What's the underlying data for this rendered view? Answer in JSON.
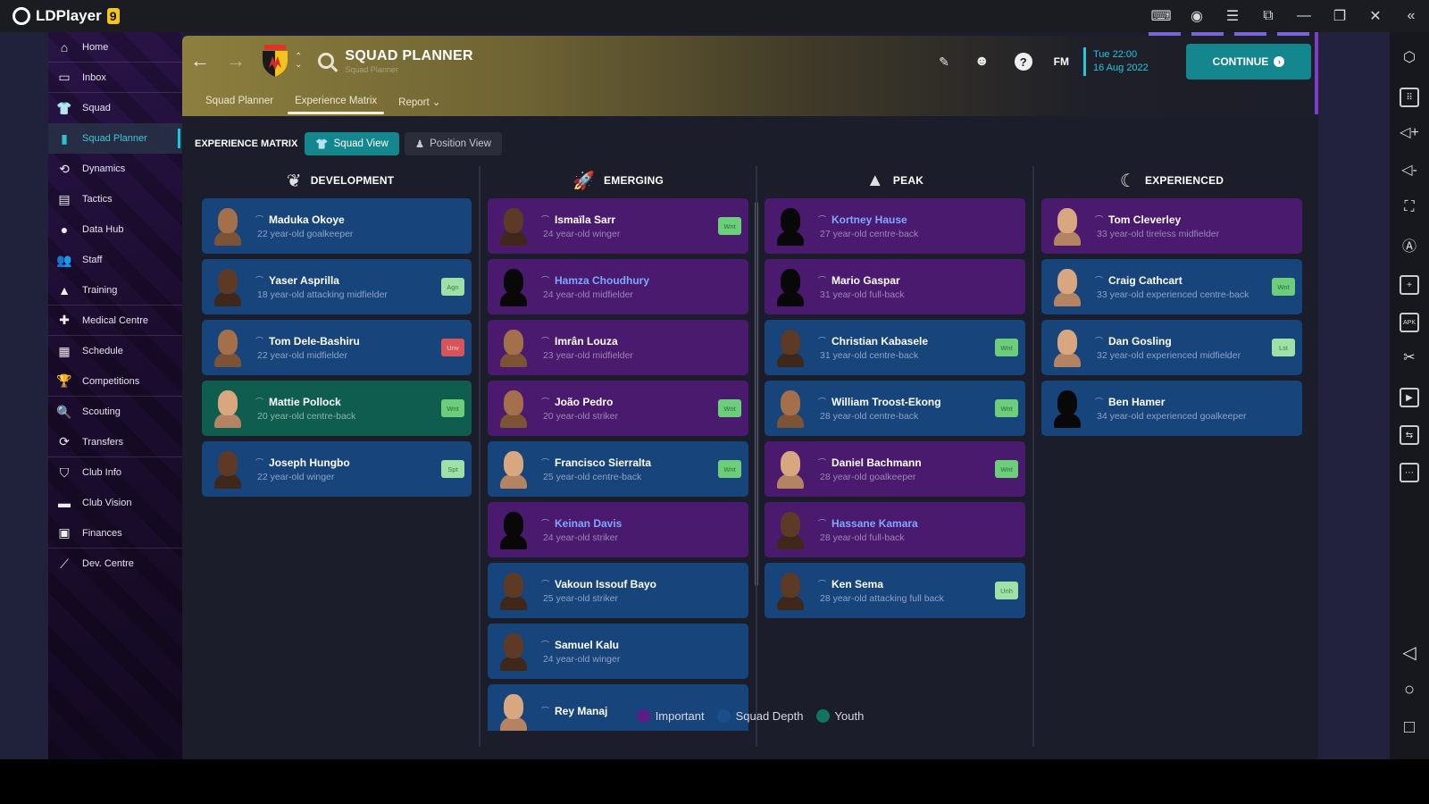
{
  "emulator": {
    "app_name": "LDPlayer",
    "version_badge": "9",
    "titlebar_icons": [
      "gamepad-icon",
      "account-icon",
      "menu-icon",
      "sync-icon",
      "minimize-icon",
      "restore-icon",
      "close-icon",
      "collapse-icon"
    ],
    "right_toolbar": [
      "settings-icon",
      "keyboard-icon",
      "volume-up-icon",
      "volume-down-icon",
      "fullscreen-icon",
      "rotate-icon",
      "multi-instance-icon",
      "apk-install-icon",
      "screenshot-icon",
      "record-icon",
      "sync-icon",
      "more-icon"
    ],
    "android_nav": [
      "back-icon",
      "home-icon",
      "recents-icon"
    ]
  },
  "sidebar": {
    "items": [
      {
        "label": "Home",
        "icon": "home-icon"
      },
      {
        "label": "Inbox",
        "icon": "inbox-icon"
      },
      {
        "label": "Squad",
        "icon": "shirt-icon"
      },
      {
        "label": "Squad Planner",
        "icon": "clipboard-icon",
        "active": true
      },
      {
        "label": "Dynamics",
        "icon": "dynamics-icon"
      },
      {
        "label": "Tactics",
        "icon": "tactics-icon"
      },
      {
        "label": "Data Hub",
        "icon": "data-hub-icon"
      },
      {
        "label": "Staff",
        "icon": "staff-icon"
      },
      {
        "label": "Training",
        "icon": "training-icon"
      },
      {
        "label": "Medical Centre",
        "icon": "medical-icon"
      },
      {
        "label": "Schedule",
        "icon": "calendar-icon"
      },
      {
        "label": "Competitions",
        "icon": "trophy-icon"
      },
      {
        "label": "Scouting",
        "icon": "search-icon"
      },
      {
        "label": "Transfers",
        "icon": "transfer-icon"
      },
      {
        "label": "Club Info",
        "icon": "shield-icon"
      },
      {
        "label": "Club Vision",
        "icon": "briefcase-icon"
      },
      {
        "label": "Finances",
        "icon": "money-icon"
      },
      {
        "label": "Dev. Centre",
        "icon": "growth-icon"
      }
    ]
  },
  "header": {
    "title": "SQUAD PLANNER",
    "subtitle": "Squad Planner",
    "date_line1": "Tue 22:00",
    "date_line2": "16 Aug 2022",
    "fm_label": "FM",
    "continue_label": "CONTINUE",
    "tabs": [
      {
        "label": "Squad Planner"
      },
      {
        "label": "Experience Matrix",
        "active": true
      },
      {
        "label": "Report ⌄"
      }
    ]
  },
  "matrix": {
    "label": "EXPERIENCE MATRIX",
    "views": [
      {
        "label": "Squad View",
        "active": true
      },
      {
        "label": "Position View"
      }
    ]
  },
  "columns": [
    {
      "title": "DEVELOPMENT",
      "icon": "sprout-icon",
      "players": [
        {
          "name": "Maduka Okoye",
          "desc": "22 year-old goalkeeper",
          "type": "depth",
          "face": "mid",
          "badge": ""
        },
        {
          "name": "Yaser Asprilla",
          "desc": "18 year-old attacking midfielder",
          "type": "depth",
          "face": "dark",
          "badge": "Agn"
        },
        {
          "name": "Tom Dele-Bashiru",
          "desc": "22 year-old midfielder",
          "type": "depth",
          "face": "mid",
          "badge": "Unv"
        },
        {
          "name": "Mattie Pollock",
          "desc": "20 year-old centre-back",
          "type": "youth",
          "face": "light",
          "badge": "Wnt"
        },
        {
          "name": "Joseph Hungbo",
          "desc": "22 year-old winger",
          "type": "depth",
          "face": "dark",
          "badge": "Spt"
        }
      ]
    },
    {
      "title": "EMERGING",
      "icon": "rocket-icon",
      "players": [
        {
          "name": "Ismaïla Sarr",
          "desc": "24 year-old winger",
          "type": "important",
          "face": "dark",
          "badge": "Wnt"
        },
        {
          "name": "Hamza Choudhury",
          "desc": "24 year-old midfielder",
          "type": "important",
          "face": "sil",
          "badge": "",
          "link": true
        },
        {
          "name": "Imrân Louza",
          "desc": "23 year-old midfielder",
          "type": "important",
          "face": "mid",
          "badge": ""
        },
        {
          "name": "João Pedro",
          "desc": "20 year-old striker",
          "type": "important",
          "face": "mid",
          "badge": "Wnt"
        },
        {
          "name": "Francisco Sierralta",
          "desc": "25 year-old centre-back",
          "type": "depth",
          "face": "light",
          "badge": "Wnt"
        },
        {
          "name": "Keinan Davis",
          "desc": "24 year-old striker",
          "type": "important",
          "face": "sil",
          "badge": "",
          "link": true
        },
        {
          "name": "Vakoun Issouf Bayo",
          "desc": "25 year-old striker",
          "type": "depth",
          "face": "dark",
          "badge": ""
        },
        {
          "name": "Samuel Kalu",
          "desc": "24 year-old winger",
          "type": "depth",
          "face": "dark",
          "badge": ""
        },
        {
          "name": "Rey Manaj",
          "desc": "",
          "type": "depth",
          "face": "light",
          "badge": ""
        }
      ]
    },
    {
      "title": "PEAK",
      "icon": "mountain-icon",
      "players": [
        {
          "name": "Kortney Hause",
          "desc": "27 year-old centre-back",
          "type": "important",
          "face": "sil",
          "badge": "",
          "link": true
        },
        {
          "name": "Mario Gaspar",
          "desc": "31 year-old full-back",
          "type": "important",
          "face": "sil",
          "badge": ""
        },
        {
          "name": "Christian Kabasele",
          "desc": "31 year-old centre-back",
          "type": "depth",
          "face": "dark",
          "badge": "Wnt"
        },
        {
          "name": "William Troost-Ekong",
          "desc": "28 year-old centre-back",
          "type": "depth",
          "face": "mid",
          "badge": "Wnt"
        },
        {
          "name": "Daniel Bachmann",
          "desc": "28 year-old goalkeeper",
          "type": "important",
          "face": "light",
          "badge": "Wnt"
        },
        {
          "name": "Hassane Kamara",
          "desc": "28 year-old full-back",
          "type": "important",
          "face": "dark",
          "badge": "",
          "link": true
        },
        {
          "name": "Ken Sema",
          "desc": "28 year-old attacking full back",
          "type": "depth",
          "face": "dark",
          "badge": "Unh"
        }
      ]
    },
    {
      "title": "EXPERIENCED",
      "icon": "moon-icon",
      "players": [
        {
          "name": "Tom Cleverley",
          "desc": "33 year-old tireless midfielder",
          "type": "important",
          "face": "light",
          "badge": ""
        },
        {
          "name": "Craig Cathcart",
          "desc": "33 year-old experienced centre-back",
          "type": "depth",
          "face": "light",
          "badge": "Wnt"
        },
        {
          "name": "Dan Gosling",
          "desc": "32 year-old experienced midfielder",
          "type": "depth",
          "face": "light",
          "badge": "Lst"
        },
        {
          "name": "Ben Hamer",
          "desc": "34 year-old experienced goalkeeper",
          "type": "depth",
          "face": "sil",
          "badge": ""
        }
      ]
    }
  ],
  "legend": [
    {
      "label": "Important",
      "color": "#5a1f86"
    },
    {
      "label": "Squad Depth",
      "color": "#1b4f8c"
    },
    {
      "label": "Youth",
      "color": "#107460"
    }
  ],
  "colors": {
    "accent": "#14878e",
    "date": "#1ec8e0",
    "important": "#4a1a6e",
    "squad_depth": "#17447a",
    "youth": "#0f5d4e"
  }
}
